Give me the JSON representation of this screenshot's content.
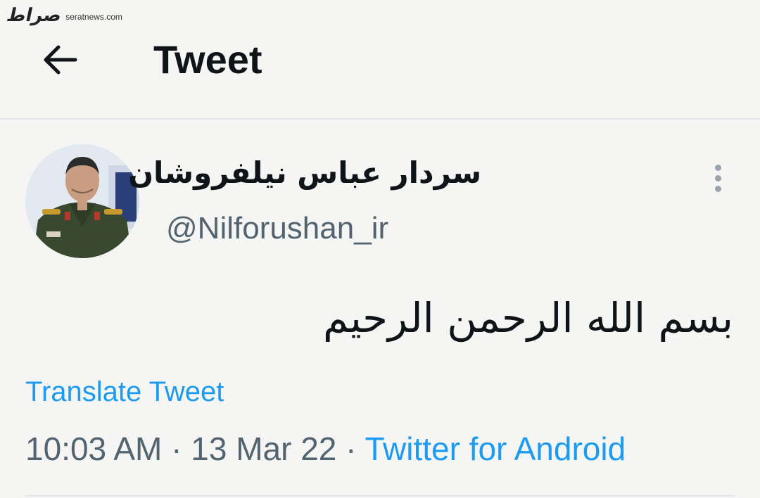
{
  "watermark": {
    "logo_text": "صراط",
    "site": "seratnews.com"
  },
  "header": {
    "title": "Tweet",
    "back_icon": "arrow-left-icon"
  },
  "author": {
    "display_name": "سردار عباس نیلفروشان",
    "handle": "@Nilforushan_ir",
    "more_icon": "vertical-ellipsis-icon"
  },
  "tweet": {
    "text": "بسم الله الرحمن الرحیم",
    "translate_label": "Translate Tweet",
    "time": "10:03 AM",
    "separator": " · ",
    "date": "13 Mar 22",
    "source": "Twitter for Android"
  },
  "colors": {
    "link": "#1d9bf0",
    "secondary": "#536471",
    "primary": "#0f1419"
  }
}
